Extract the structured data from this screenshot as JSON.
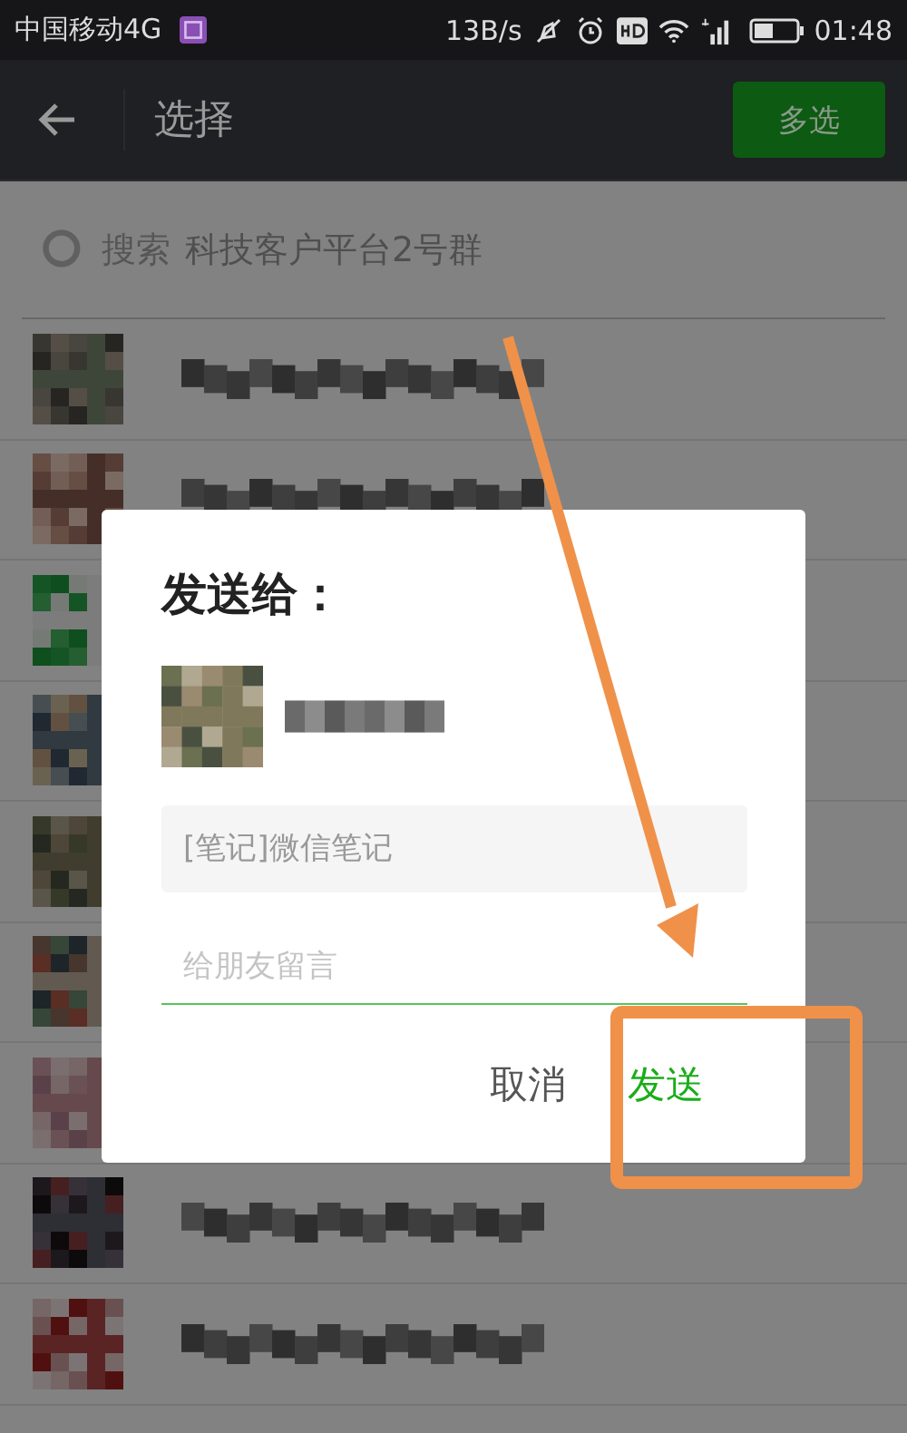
{
  "status_bar": {
    "carrier": "中国移动4G",
    "speed": "13B/s",
    "time": "01:48"
  },
  "header": {
    "title": "选择",
    "action": "多选"
  },
  "search": {
    "placeholder": "搜索",
    "ghost_text": "科技客户平台2号群"
  },
  "contacts": [
    {
      "kind": "picture"
    },
    {
      "kind": "picture"
    },
    {
      "kind": "picture",
      "name_hidden": true
    },
    {
      "kind": "picture",
      "name_hidden": true
    },
    {
      "kind": "picture",
      "name_hidden": true
    },
    {
      "kind": "picture",
      "name_hidden": true
    },
    {
      "kind": "picture"
    },
    {
      "kind": "picture"
    },
    {
      "kind": "picture"
    }
  ],
  "dialog": {
    "title": "发送给：",
    "recipient": {
      "kind": "picture"
    },
    "preview": "[笔记]微信笔记",
    "message_placeholder": "给朋友留言",
    "buttons": [
      {
        "label": "取消",
        "kind": "cancel"
      },
      {
        "label": "发送",
        "kind": "primary"
      }
    ]
  },
  "annotation": {
    "kind": "arrow_and_box"
  }
}
